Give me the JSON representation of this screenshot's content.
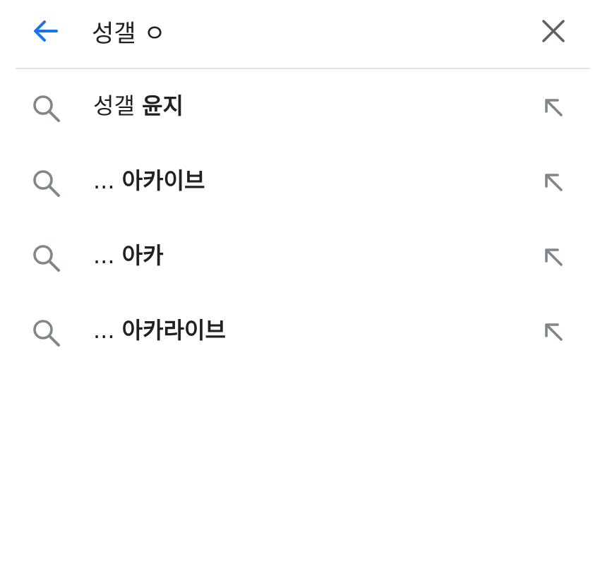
{
  "search": {
    "query": "성갤 ㅇ"
  },
  "icons": {
    "back": "arrow-back-icon",
    "clear": "close-icon",
    "suggestion": "search-icon",
    "fill": "arrow-up-left-icon"
  },
  "colors": {
    "accent": "#1a73e8",
    "text": "#202124",
    "icon_gray": "#80868b",
    "divider": "#e3e3e3"
  },
  "suggestions": [
    {
      "prefix": "성갤 ",
      "bold": "윤지"
    },
    {
      "prefix": "... ",
      "bold": "아카이브"
    },
    {
      "prefix": "... ",
      "bold": "아카"
    },
    {
      "prefix": "... ",
      "bold": "아카라이브"
    }
  ]
}
